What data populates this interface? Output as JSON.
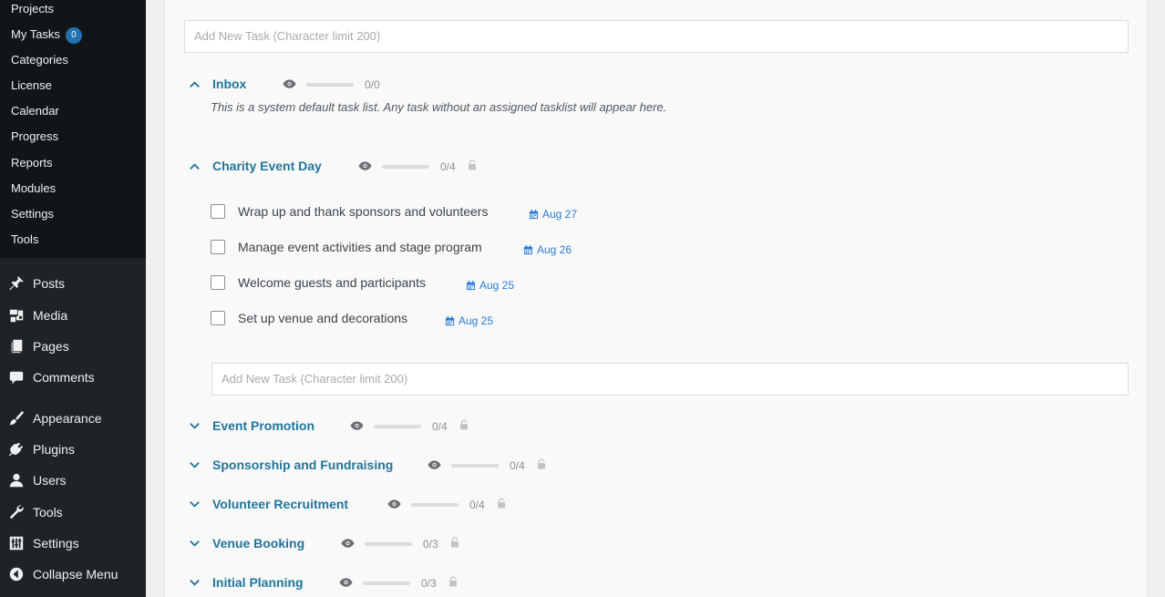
{
  "sidebar": {
    "submenu": [
      {
        "label": "Projects"
      },
      {
        "label": "My Tasks",
        "badge": "0"
      },
      {
        "label": "Categories"
      },
      {
        "label": "License"
      },
      {
        "label": "Calendar"
      },
      {
        "label": "Progress"
      },
      {
        "label": "Reports"
      },
      {
        "label": "Modules"
      },
      {
        "label": "Settings"
      },
      {
        "label": "Tools"
      }
    ],
    "menu": [
      {
        "label": "Posts",
        "icon": "pin-icon"
      },
      {
        "label": "Media",
        "icon": "media-icon"
      },
      {
        "label": "Pages",
        "icon": "pages-icon"
      },
      {
        "label": "Comments",
        "icon": "comment-icon"
      },
      {
        "label": "Appearance",
        "icon": "brush-icon"
      },
      {
        "label": "Plugins",
        "icon": "plug-icon"
      },
      {
        "label": "Users",
        "icon": "user-icon"
      },
      {
        "label": "Tools",
        "icon": "wrench-icon"
      },
      {
        "label": "Settings",
        "icon": "sliders-icon"
      },
      {
        "label": "Collapse Menu",
        "icon": "collapse-icon"
      }
    ]
  },
  "main": {
    "add_task_placeholder": "Add New Task (Character limit 200)",
    "lists": [
      {
        "title": "Inbox",
        "count": "0/0",
        "expanded": true,
        "description": "This is a system default task list. Any task without an assigned tasklist will appear here."
      },
      {
        "title": "Charity Event Day",
        "count": "0/4",
        "expanded": true
      },
      {
        "title": "Event Promotion",
        "count": "0/4",
        "expanded": false
      },
      {
        "title": "Sponsorship and Fundraising",
        "count": "0/4",
        "expanded": false
      },
      {
        "title": "Volunteer Recruitment",
        "count": "0/4",
        "expanded": false
      },
      {
        "title": "Venue Booking",
        "count": "0/3",
        "expanded": false
      },
      {
        "title": "Initial Planning",
        "count": "0/3",
        "expanded": false
      }
    ],
    "tasks": [
      {
        "label": "Wrap up and thank sponsors and volunteers",
        "due": "Aug 27"
      },
      {
        "label": "Manage event activities and stage program",
        "due": "Aug 26"
      },
      {
        "label": "Welcome guests and participants",
        "due": "Aug 25"
      },
      {
        "label": "Set up venue and decorations",
        "due": "Aug 25"
      }
    ]
  },
  "colors": {
    "sidebar_bg": "#1d2327",
    "submenu_bg": "#101517",
    "badge": "#2271b1",
    "list_title": "#21759b",
    "due_date": "#2b7cd3"
  }
}
